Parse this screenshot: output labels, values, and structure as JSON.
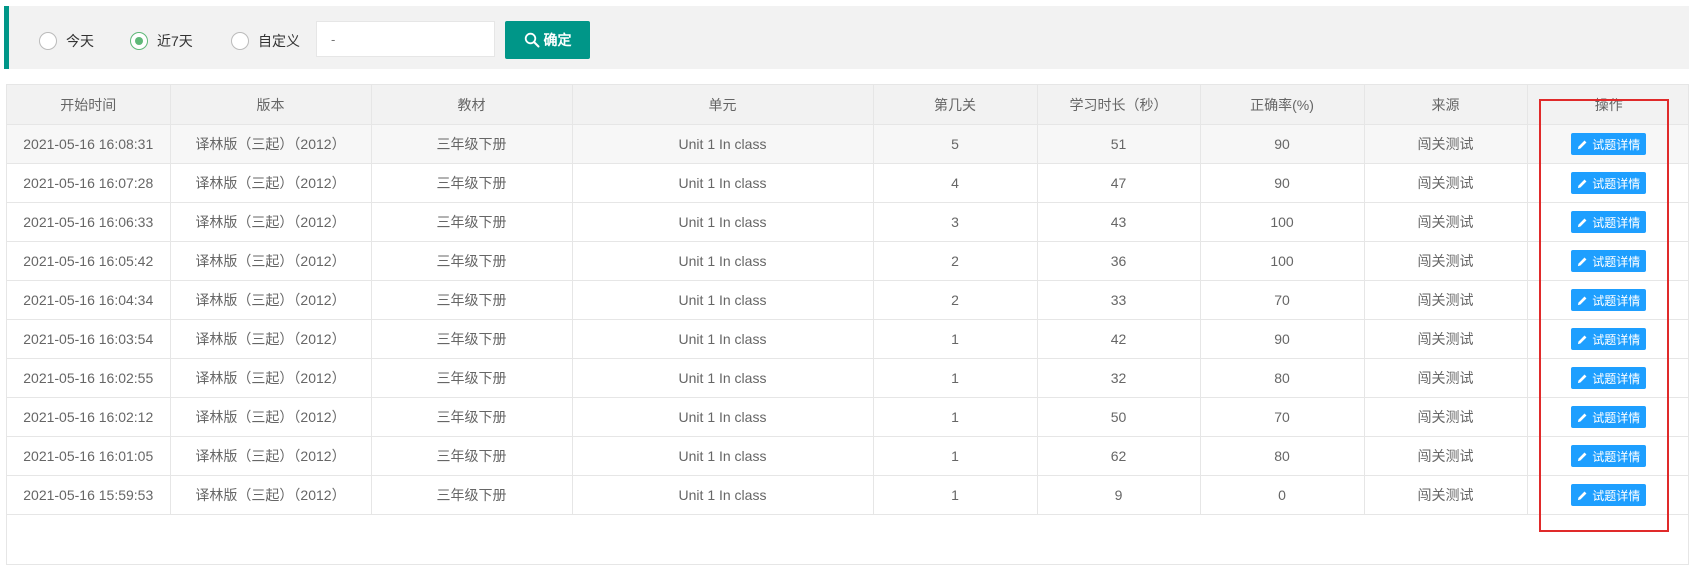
{
  "filter": {
    "options": [
      {
        "label": "今天",
        "checked": false
      },
      {
        "label": "近7天",
        "checked": true
      },
      {
        "label": "自定义",
        "checked": false
      }
    ],
    "date_range_placeholder": "-",
    "confirm_label": "确定"
  },
  "table": {
    "headers": [
      "开始时间",
      "版本",
      "教材",
      "单元",
      "第几关",
      "学习时长（秒）",
      "正确率(%)",
      "来源",
      "操作"
    ],
    "action_label": "试题详情",
    "rows": [
      [
        "2021-05-16 16:08:31",
        "译林版（三起）（2012）",
        "三年级下册",
        "Unit 1 In class",
        "5",
        "51",
        "90",
        "闯关测试"
      ],
      [
        "2021-05-16 16:07:28",
        "译林版（三起）（2012）",
        "三年级下册",
        "Unit 1 In class",
        "4",
        "47",
        "90",
        "闯关测试"
      ],
      [
        "2021-05-16 16:06:33",
        "译林版（三起）（2012）",
        "三年级下册",
        "Unit 1 In class",
        "3",
        "43",
        "100",
        "闯关测试"
      ],
      [
        "2021-05-16 16:05:42",
        "译林版（三起）（2012）",
        "三年级下册",
        "Unit 1 In class",
        "2",
        "36",
        "100",
        "闯关测试"
      ],
      [
        "2021-05-16 16:04:34",
        "译林版（三起）（2012）",
        "三年级下册",
        "Unit 1 In class",
        "2",
        "33",
        "70",
        "闯关测试"
      ],
      [
        "2021-05-16 16:03:54",
        "译林版（三起）（2012）",
        "三年级下册",
        "Unit 1 In class",
        "1",
        "42",
        "90",
        "闯关测试"
      ],
      [
        "2021-05-16 16:02:55",
        "译林版（三起）（2012）",
        "三年级下册",
        "Unit 1 In class",
        "1",
        "32",
        "80",
        "闯关测试"
      ],
      [
        "2021-05-16 16:02:12",
        "译林版（三起）（2012）",
        "三年级下册",
        "Unit 1 In class",
        "1",
        "50",
        "70",
        "闯关测试"
      ],
      [
        "2021-05-16 16:01:05",
        "译林版（三起）（2012）",
        "三年级下册",
        "Unit 1 In class",
        "1",
        "62",
        "80",
        "闯关测试"
      ],
      [
        "2021-05-16 15:59:53",
        "译林版（三起）（2012）",
        "三年级下册",
        "Unit 1 In class",
        "1",
        "9",
        "0",
        "闯关测试"
      ]
    ]
  },
  "colors": {
    "accent_teal": "#009688",
    "radio_checked": "#5fb878",
    "action_blue": "#1e9fff",
    "highlight_red": "#e02a2a"
  },
  "icons": {
    "confirm": "search-icon",
    "action": "edit-icon"
  }
}
